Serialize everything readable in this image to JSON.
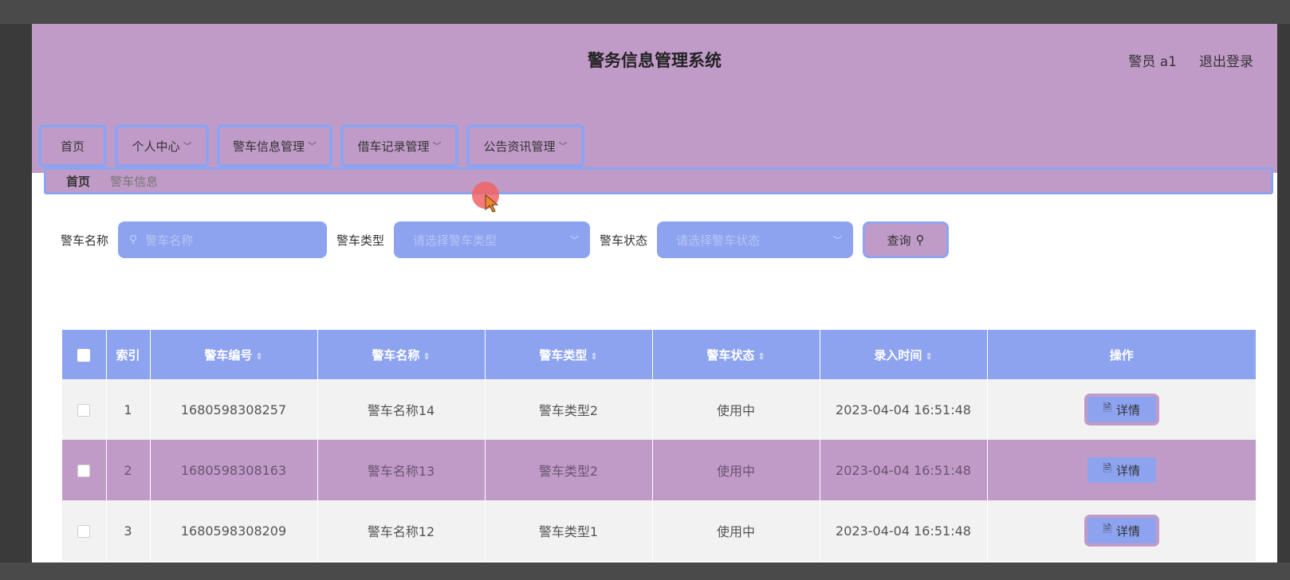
{
  "header": {
    "title": "警务信息管理系统",
    "user": "警员 a1",
    "logout": "退出登录"
  },
  "nav": [
    {
      "label": "首页",
      "dropdown": false
    },
    {
      "label": "个人中心",
      "dropdown": true
    },
    {
      "label": "警车信息管理",
      "dropdown": true
    },
    {
      "label": "借车记录管理",
      "dropdown": true
    },
    {
      "label": "公告资讯管理",
      "dropdown": true
    }
  ],
  "breadcrumb": {
    "home": "首页",
    "current": "警车信息"
  },
  "search": {
    "name_label": "警车名称",
    "name_placeholder": "警车名称",
    "type_label": "警车类型",
    "type_placeholder": "请选择警车类型",
    "status_label": "警车状态",
    "status_placeholder": "请选择警车状态",
    "query_label": "查询"
  },
  "table": {
    "headers": [
      "索引",
      "警车编号",
      "警车名称",
      "警车类型",
      "警车状态",
      "录入时间",
      "操作"
    ],
    "rows": [
      {
        "index": "1",
        "code": "1680598308257",
        "name": "警车名称14",
        "type": "警车类型2",
        "status": "使用中",
        "time": "2023-04-04 16:51:48"
      },
      {
        "index": "2",
        "code": "1680598308163",
        "name": "警车名称13",
        "type": "警车类型2",
        "status": "使用中",
        "time": "2023-04-04 16:51:48"
      },
      {
        "index": "3",
        "code": "1680598308209",
        "name": "警车名称12",
        "type": "警车类型1",
        "status": "使用中",
        "time": "2023-04-04 16:51:48"
      }
    ],
    "action_label": "详情"
  },
  "colors": {
    "header_bg": "#c19bc8",
    "accent": "#8da3f0",
    "row_alt": "#f2f2f2"
  }
}
